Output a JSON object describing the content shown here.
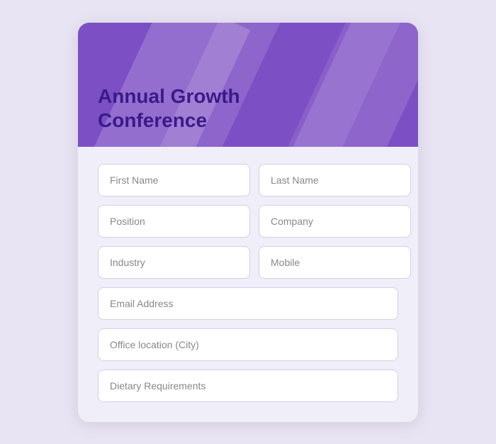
{
  "header": {
    "title_line1": "Annual Growth",
    "title_line2": "Conference",
    "bg_color": "#7c4fc4"
  },
  "form": {
    "fields": {
      "first_name": {
        "placeholder": "First Name"
      },
      "last_name": {
        "placeholder": "Last Name"
      },
      "position": {
        "placeholder": "Position"
      },
      "company": {
        "placeholder": "Company"
      },
      "industry": {
        "placeholder": "Industry"
      },
      "mobile": {
        "placeholder": "Mobile"
      },
      "email": {
        "placeholder": "Email Address"
      },
      "office_location": {
        "placeholder": "Office location (City)"
      },
      "dietary": {
        "placeholder": "Dietary Requirements"
      }
    }
  }
}
